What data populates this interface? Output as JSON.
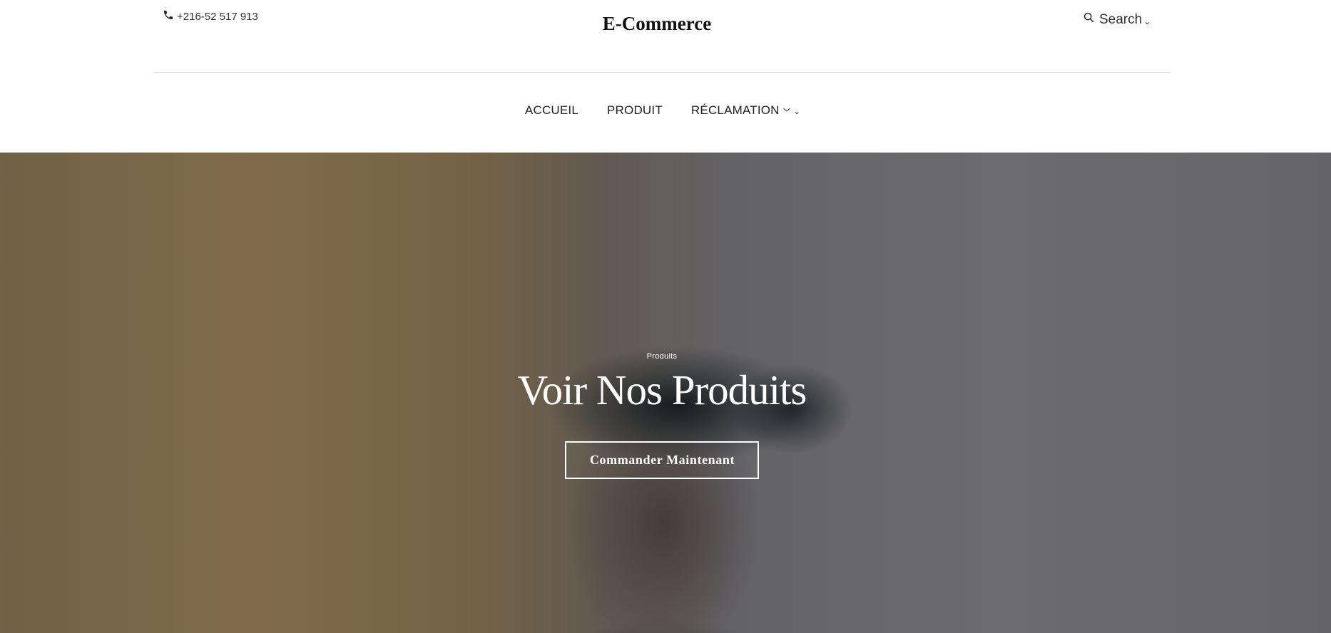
{
  "header": {
    "phone": "+216-52 517 913",
    "brand": "E-Commerce",
    "search_label": "Search"
  },
  "nav": {
    "items": [
      {
        "label": "ACCUEIL"
      },
      {
        "label": "PRODUIT"
      },
      {
        "label": "RÉCLAMATION",
        "has_dropdown": true
      }
    ]
  },
  "hero": {
    "eyebrow": "Produits",
    "title": "Voir Nos Produits",
    "cta_label": "Commander Maintenant"
  },
  "icons": {
    "phone": "phone-icon",
    "search": "search-icon",
    "dropdown": "chevron-down-icon"
  },
  "colors": {
    "text_dark": "#222222",
    "hero_text": "#ffffff",
    "divider": "#e2e2e2"
  }
}
